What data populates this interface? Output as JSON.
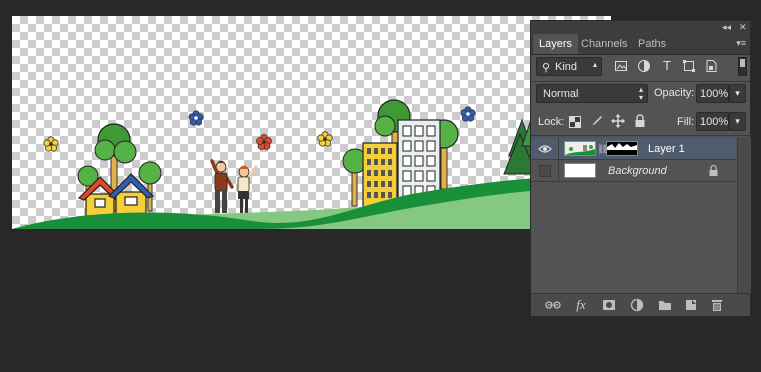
{
  "panel": {
    "collapse_glyph": "◂◂",
    "close_glyph": "✕",
    "menu_glyph": "▾≡",
    "tabs": [
      {
        "label": "Layers",
        "active": true
      },
      {
        "label": "Channels",
        "active": false
      },
      {
        "label": "Paths",
        "active": false
      }
    ],
    "filter": {
      "search_glyph": "⚲",
      "kind_label": "Kind",
      "icons": [
        "image-filter-icon",
        "adjustment-filter-icon",
        "type-filter-icon",
        "shape-filter-icon",
        "smart-object-filter-icon"
      ],
      "type_glyph": "T"
    },
    "blend_mode": "Normal",
    "opacity_label": "Opacity:",
    "opacity_value": "100%",
    "lock_label": "Lock:",
    "fill_label": "Fill:",
    "fill_value": "100%",
    "layers": [
      {
        "name": "Layer 1",
        "visible": true,
        "selected": true,
        "has_mask": true,
        "locked": false,
        "italic": false
      },
      {
        "name": "Background",
        "visible": false,
        "selected": false,
        "has_mask": false,
        "locked": true,
        "italic": true
      }
    ],
    "bottom_icons": [
      "link-layers-icon",
      "layer-style-icon",
      "add-mask-icon",
      "adjustment-layer-icon",
      "new-group-icon",
      "new-layer-icon",
      "delete-layer-icon"
    ],
    "fx_label": "fx"
  },
  "colors": {
    "app_background": "#282828",
    "panel_background": "#535353",
    "selected_layer": "#4f5c6e",
    "hill_dark": "#1a8f3a",
    "hill_light": "#84c882"
  }
}
